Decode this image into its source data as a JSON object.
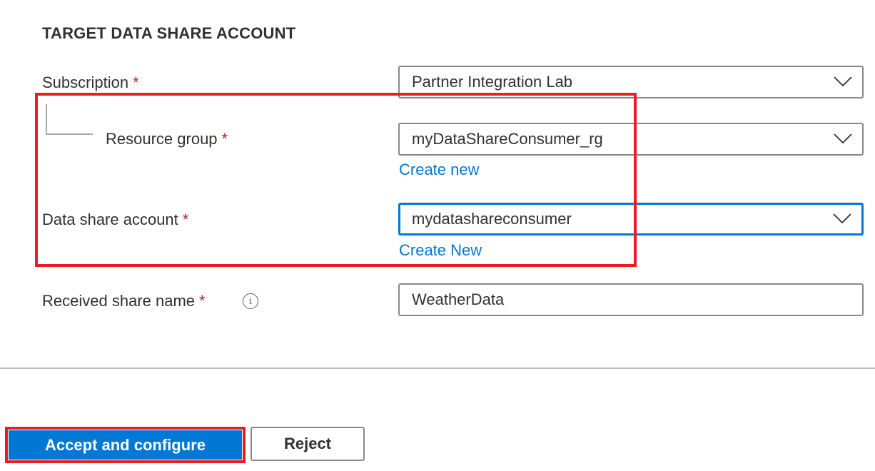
{
  "section": {
    "title": "TARGET DATA SHARE ACCOUNT"
  },
  "fields": {
    "subscription": {
      "label": "Subscription",
      "required_mark": "*",
      "value": "Partner Integration Lab"
    },
    "resource_group": {
      "label": "Resource group",
      "required_mark": "*",
      "value": "myDataShareConsumer_rg",
      "create_link": "Create new"
    },
    "data_share_account": {
      "label": "Data share account",
      "required_mark": "*",
      "value": "mydatashareconsumer",
      "create_link": "Create New"
    },
    "received_share_name": {
      "label": "Received share name",
      "required_mark": "*",
      "info_icon": "i",
      "value": "WeatherData"
    }
  },
  "actions": {
    "accept_label": "Accept and configure",
    "reject_label": "Reject"
  },
  "colors": {
    "accent": "#0078d4",
    "required": "#a4262c",
    "annotation_highlight": "#ed1c24"
  }
}
